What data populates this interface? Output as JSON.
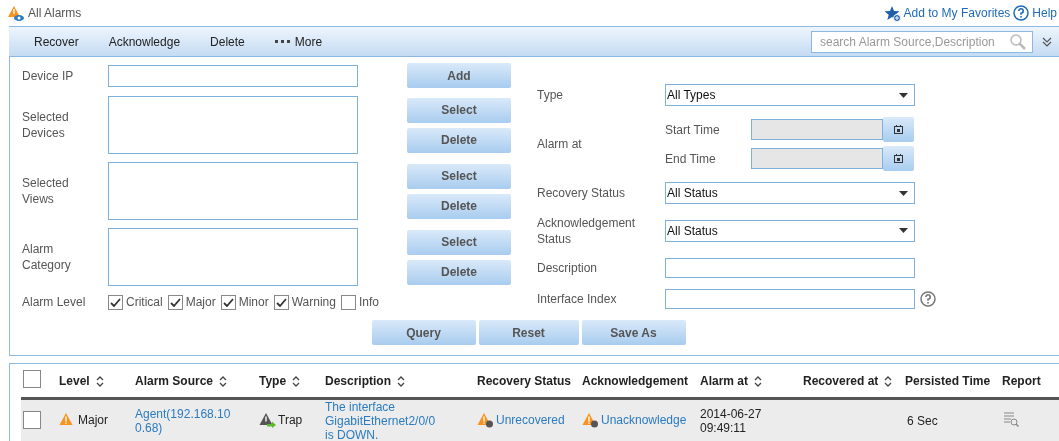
{
  "header": {
    "title": "All Alarms",
    "favorites": "Add to My Favorites",
    "help": "Help"
  },
  "toolbar": {
    "actions": [
      "Recover",
      "Acknowledge",
      "Delete"
    ],
    "more": "More",
    "search": {
      "placeholder": "search Alarm Source,Description"
    }
  },
  "filters": {
    "device_ip": {
      "label": "Device IP",
      "button": "Add"
    },
    "lists": [
      {
        "label": "Selected Devices",
        "buttons": [
          "Select",
          "Delete"
        ]
      },
      {
        "label": "Selected Views",
        "buttons": [
          "Select",
          "Delete"
        ]
      },
      {
        "label": "Alarm Category",
        "buttons": [
          "Select",
          "Delete"
        ]
      }
    ],
    "alarm_level": {
      "label": "Alarm Level",
      "options": [
        {
          "label": "Critical",
          "checked": true
        },
        {
          "label": "Major",
          "checked": true
        },
        {
          "label": "Minor",
          "checked": true
        },
        {
          "label": "Warning",
          "checked": true
        },
        {
          "label": "Info",
          "checked": false
        }
      ]
    },
    "type": {
      "label": "Type",
      "value": "All Types"
    },
    "alarm_at": {
      "label": "Alarm at",
      "start": "Start Time",
      "end": "End Time"
    },
    "recovery_status": {
      "label": "Recovery Status",
      "value": "All Status"
    },
    "ack_status": {
      "label": "Acknowledgement Status",
      "value": "All Status"
    },
    "description": {
      "label": "Description"
    },
    "interface_index": {
      "label": "Interface Index"
    },
    "buttons": [
      "Query",
      "Reset",
      "Save As"
    ]
  },
  "table": {
    "all_selected": false,
    "columns": [
      {
        "label": "Level",
        "sortable": true
      },
      {
        "label": "Alarm Source",
        "sortable": true
      },
      {
        "label": "Type",
        "sortable": true
      },
      {
        "label": "Description",
        "sortable": true
      },
      {
        "label": "Recovery Status",
        "sortable": false
      },
      {
        "label": "Acknowledgement",
        "sortable": false
      },
      {
        "label": "Alarm at",
        "sortable": true
      },
      {
        "label": "Recovered at",
        "sortable": true
      },
      {
        "label": "Persisted Time",
        "sortable": false
      },
      {
        "label": "Report",
        "sortable": false
      }
    ],
    "rows": [
      {
        "selected": false,
        "level": "Major",
        "source": "Agent(192.168.10 0.68)",
        "type": "Trap",
        "description": "The interface GigabitEthernet2/0/0 is DOWN.",
        "recovery": "Unrecovered",
        "ack": "Unacknowledge",
        "alarm_at": "2014-06-27 09:49:11",
        "persisted": "6 Sec"
      }
    ]
  }
}
